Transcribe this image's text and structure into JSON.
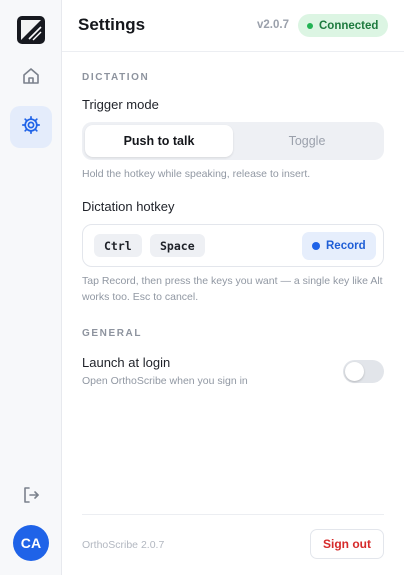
{
  "app": {
    "title": "Settings",
    "version": "v2.0.7",
    "status": "Connected"
  },
  "sidebar": {
    "items": [
      {
        "name": "home",
        "icon": "home-icon"
      },
      {
        "name": "settings",
        "icon": "gear-icon",
        "active": true
      }
    ],
    "logout_icon": "logout-icon",
    "avatar_initials": "CA"
  },
  "dictation": {
    "section_label": "DICTATION",
    "trigger_mode_label": "Trigger mode",
    "trigger_options": [
      "Push to talk",
      "Toggle"
    ],
    "trigger_selected": "Push to talk",
    "trigger_hint": "Hold the hotkey while speaking, release to insert.",
    "hotkey_label": "Dictation hotkey",
    "hotkey_keys": [
      "Ctrl",
      "Space"
    ],
    "record_label": "Record",
    "hotkey_hint": "Tap Record, then press the keys you want — a single key like Alt works too. Esc to cancel."
  },
  "general": {
    "section_label": "GENERAL",
    "launch_label": "Launch at login",
    "launch_hint": "Open OrthoScribe when you sign in",
    "launch_enabled": false
  },
  "footer": {
    "app_version": "OrthoScribe 2.0.7",
    "signout_label": "Sign out"
  },
  "colors": {
    "accent": "#1f63e8",
    "status_bg": "#dcf5e3",
    "status_text": "#1d7a3e",
    "danger": "#d62a2a"
  }
}
